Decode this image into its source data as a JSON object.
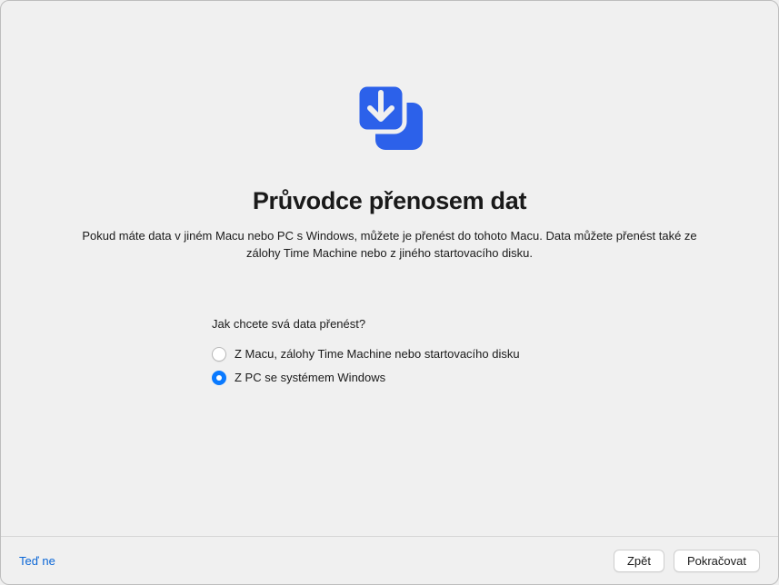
{
  "header": {
    "title": "Průvodce přenosem dat",
    "description": "Pokud máte data v jiném Macu nebo PC s Windows, můžete je přenést do tohoto Macu. Data můžete přenést také ze zálohy Time Machine nebo z jiného startovacího disku."
  },
  "form": {
    "question": "Jak chcete svá data přenést?",
    "options": [
      {
        "label": "Z Macu, zálohy Time Machine nebo startovacího disku",
        "selected": false
      },
      {
        "label": "Z PC se systémem Windows",
        "selected": true
      }
    ]
  },
  "footer": {
    "not_now": "Teď ne",
    "back": "Zpět",
    "continue": "Pokračovat"
  },
  "colors": {
    "accent": "#2c61ea",
    "radio_selected": "#0a7aff",
    "link": "#0a66d6"
  }
}
